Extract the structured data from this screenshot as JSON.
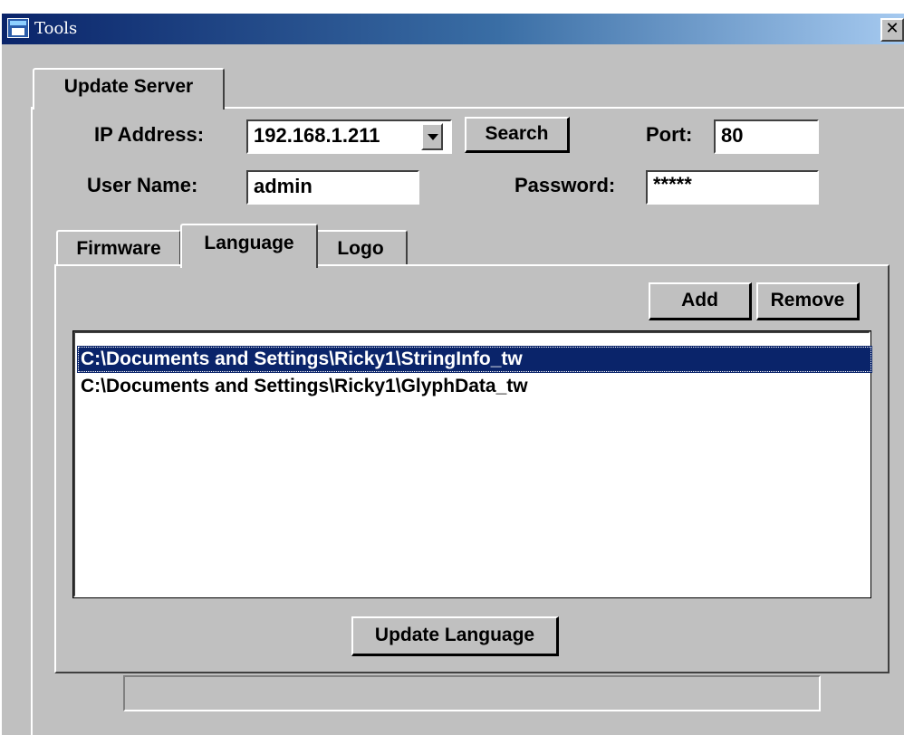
{
  "window": {
    "title": "Tools",
    "close_symbol": "✕",
    "icons": {
      "app": "app-window-icon",
      "close": "close-icon",
      "dropdown": "chevron-down-icon"
    }
  },
  "outer_tabs": [
    {
      "label": "Update Server",
      "active": true
    }
  ],
  "server": {
    "ip_label": "IP Address:",
    "ip_value": "192.168.1.211",
    "search_label": "Search",
    "port_label": "Port:",
    "port_value": "80",
    "username_label": "User Name:",
    "username_value": "admin",
    "password_label": "Password:",
    "password_value": "*****"
  },
  "inner_tabs": [
    {
      "label": "Firmware",
      "active": false
    },
    {
      "label": "Language",
      "active": true
    },
    {
      "label": "Logo",
      "active": false
    }
  ],
  "language_panel": {
    "add_label": "Add",
    "remove_label": "Remove",
    "files": [
      {
        "path": "C:\\Documents and Settings\\Ricky1\\StringInfo_tw",
        "selected": true
      },
      {
        "path": "C:\\Documents and Settings\\Ricky1\\GlyphData_tw",
        "selected": false
      }
    ],
    "update_label": "Update Language"
  },
  "status": {
    "text": ""
  },
  "colors": {
    "face": "#c0c0c0",
    "titlebar_start": "#0a246a",
    "titlebar_end": "#a6caf0",
    "selection": "#0a246a"
  }
}
